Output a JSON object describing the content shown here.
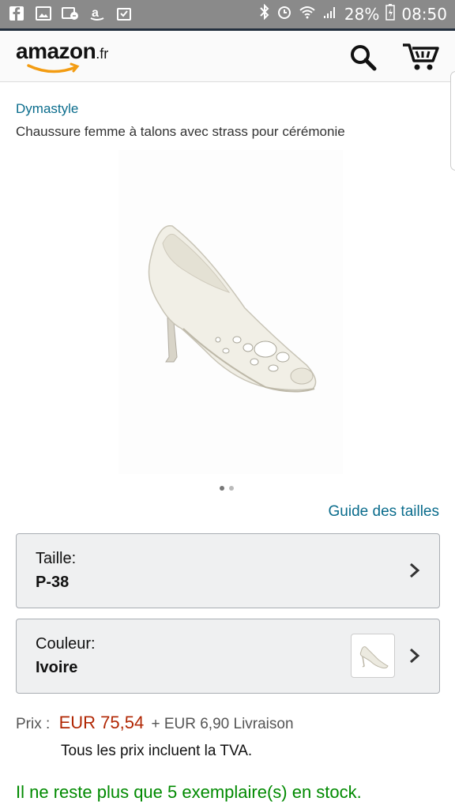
{
  "statusbar": {
    "battery": "28%",
    "time": "08:50",
    "icons_left": [
      "facebook-icon",
      "gallery-icon",
      "photo-icon",
      "amazon-icon",
      "clipboard-icon"
    ],
    "icons_right": [
      "bluetooth-icon",
      "alarm-icon",
      "wifi-icon",
      "signal-icon",
      "battery-icon"
    ]
  },
  "header": {
    "logo_text": "amazon",
    "logo_suffix": ".fr"
  },
  "product": {
    "brand": "Dymastyle",
    "title": "Chaussure femme à talons avec strass pour cérémonie"
  },
  "size_guide": "Guide des tailles",
  "size_selector": {
    "label": "Taille:",
    "value": "P-38"
  },
  "color_selector": {
    "label": "Couleur:",
    "value": "Ivoire"
  },
  "price": {
    "label": "Prix :",
    "value": "EUR 75,54",
    "shipping": "+ EUR 6,90 Livraison",
    "tax_note": "Tous les prix incluent la TVA."
  },
  "stock_message": "Il ne reste plus que 5 exemplaire(s) en stock.",
  "colors": {
    "link": "#0a6c8c",
    "price": "#b12704",
    "stock": "#008a00",
    "logo_smile": "#f39c12"
  }
}
